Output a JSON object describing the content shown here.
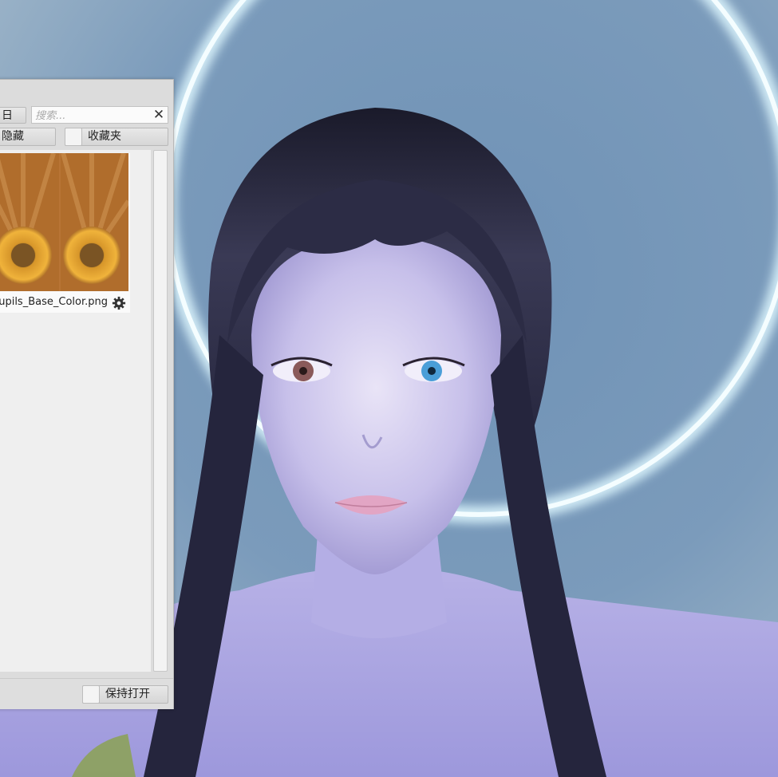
{
  "toolbar": {
    "folder_button_label": "日",
    "search_placeholder": "搜索...",
    "clear_icon": "close-icon"
  },
  "filters": {
    "hide_label": "隐藏",
    "favorites_label": "收藏夹"
  },
  "files": [
    {
      "name": "Pupils_Base_Color.png",
      "visible_name": "upils_Base_Color.png",
      "icon": "gear-icon"
    }
  ],
  "footer": {
    "keep_open_label": "保持打开"
  },
  "colors": {
    "panel_bg": "#dcdcdc",
    "list_bg": "#efefef",
    "iris_orange": "#e09a2a",
    "halo": "#e8fbff"
  }
}
